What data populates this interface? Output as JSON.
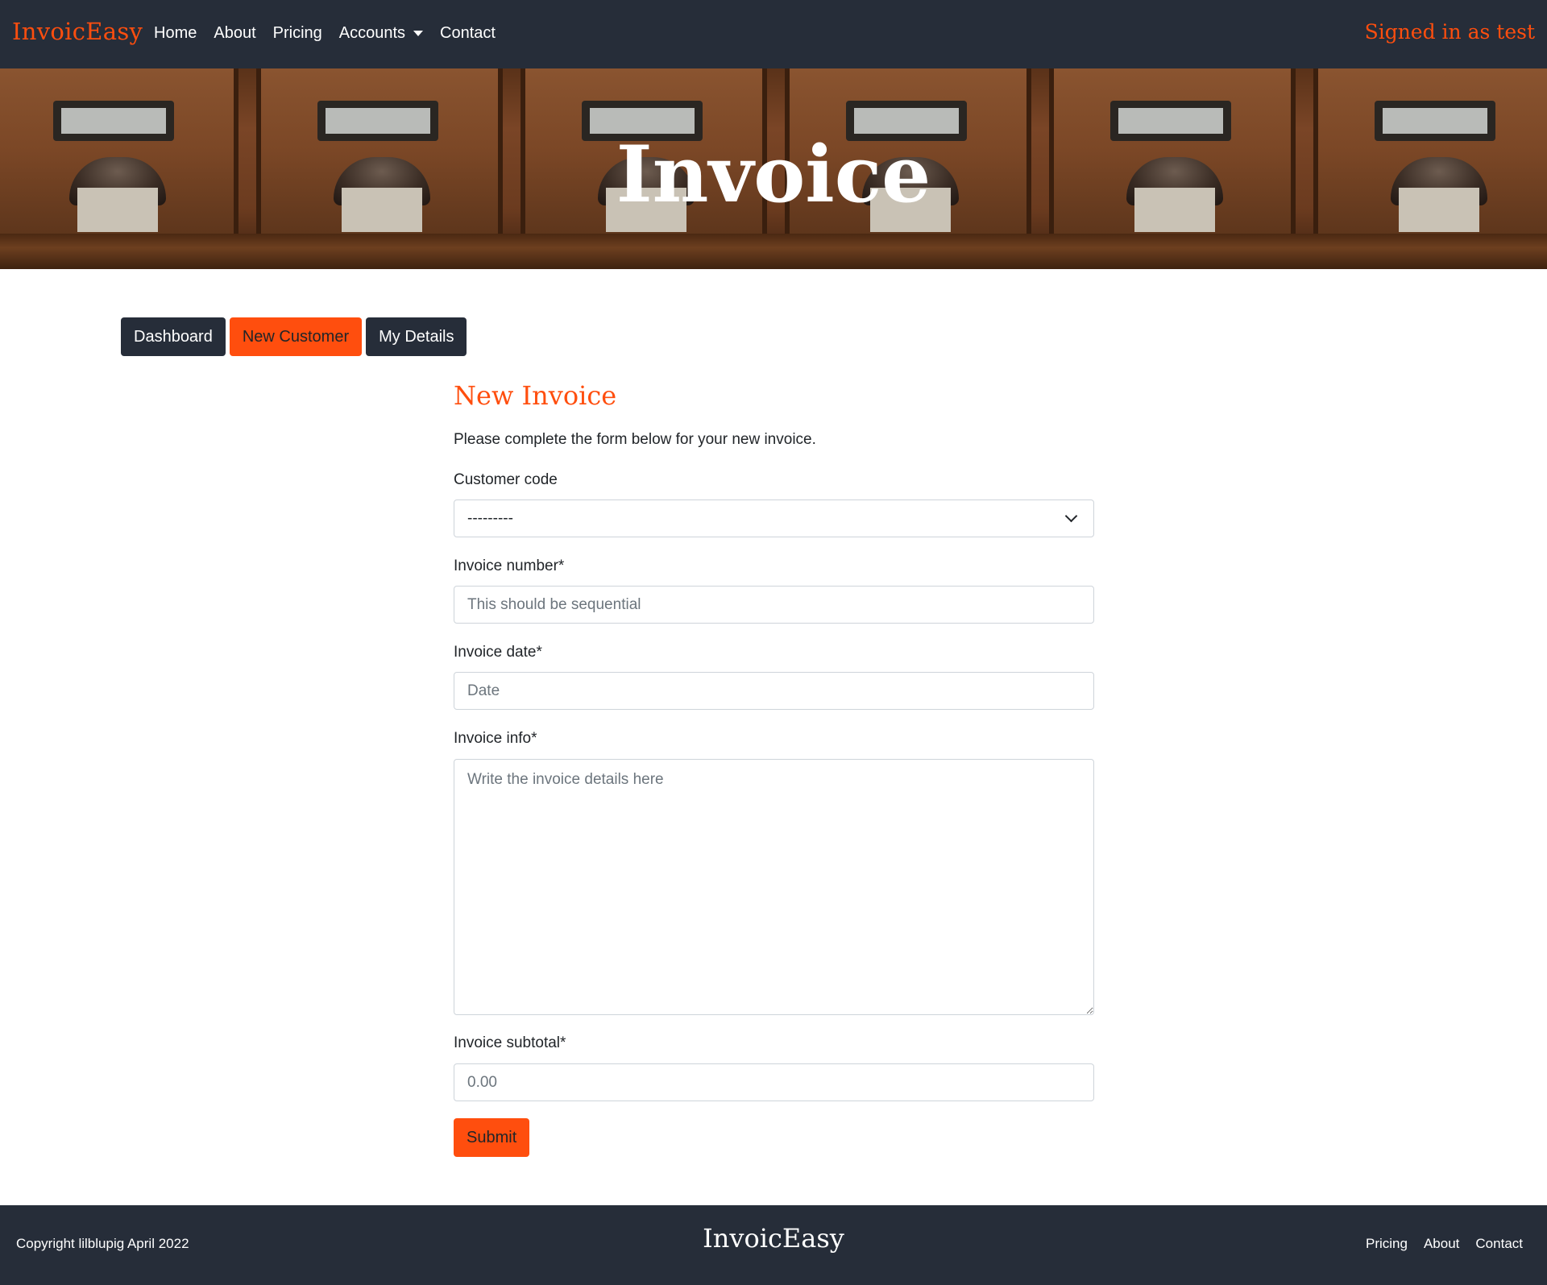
{
  "navbar": {
    "brand": "InvoicEasy",
    "links": [
      "Home",
      "About",
      "Pricing",
      "Accounts",
      "Contact"
    ],
    "signed_in": "Signed in as test"
  },
  "hero": {
    "title": "Invoice"
  },
  "subnav": {
    "dashboard": "Dashboard",
    "new_customer": "New Customer",
    "my_details": "My Details"
  },
  "form": {
    "title": "New Invoice",
    "intro": "Please complete the form below for your new invoice.",
    "customer_code_label": "Customer code",
    "customer_code_value": "---------",
    "invoice_number_label": "Invoice number*",
    "invoice_number_placeholder": "This should be sequential",
    "invoice_date_label": "Invoice date*",
    "invoice_date_placeholder": "Date",
    "invoice_info_label": "Invoice info*",
    "invoice_info_placeholder": "Write the invoice details here",
    "invoice_subtotal_label": "Invoice subtotal*",
    "invoice_subtotal_placeholder": "0.00",
    "submit": "Submit"
  },
  "footer": {
    "copyright": "Copyright lilblupig April 2022",
    "brand": "InvoicEasy",
    "links": [
      "Pricing",
      "About",
      "Contact"
    ]
  },
  "colors": {
    "accent": "#ff4e0e",
    "dark": "#262d39"
  }
}
